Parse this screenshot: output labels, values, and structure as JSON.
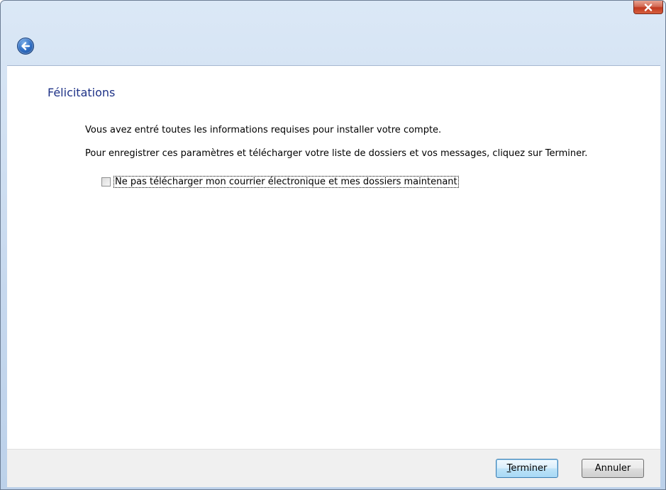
{
  "window": {
    "close_label": "Close"
  },
  "nav": {
    "back_label": "Back"
  },
  "page": {
    "title": "Félicitations",
    "paragraph1": "Vous avez entré toutes les informations requises pour installer votre compte.",
    "paragraph2": "Pour enregistrer ces paramètres et télécharger votre liste de dossiers et vos messages, cliquez sur Terminer.",
    "checkbox": {
      "label": "Ne pas télécharger mon courrier électronique et mes dossiers maintenant",
      "checked": false
    }
  },
  "footer": {
    "finish_label": "Terminer",
    "cancel_label": "Annuler"
  },
  "icons": {
    "close": "close-icon",
    "back": "back-arrow-icon"
  },
  "colors": {
    "title": "#1e3287",
    "close_button": "#c0391f",
    "back_button": "#2f6ec4"
  }
}
